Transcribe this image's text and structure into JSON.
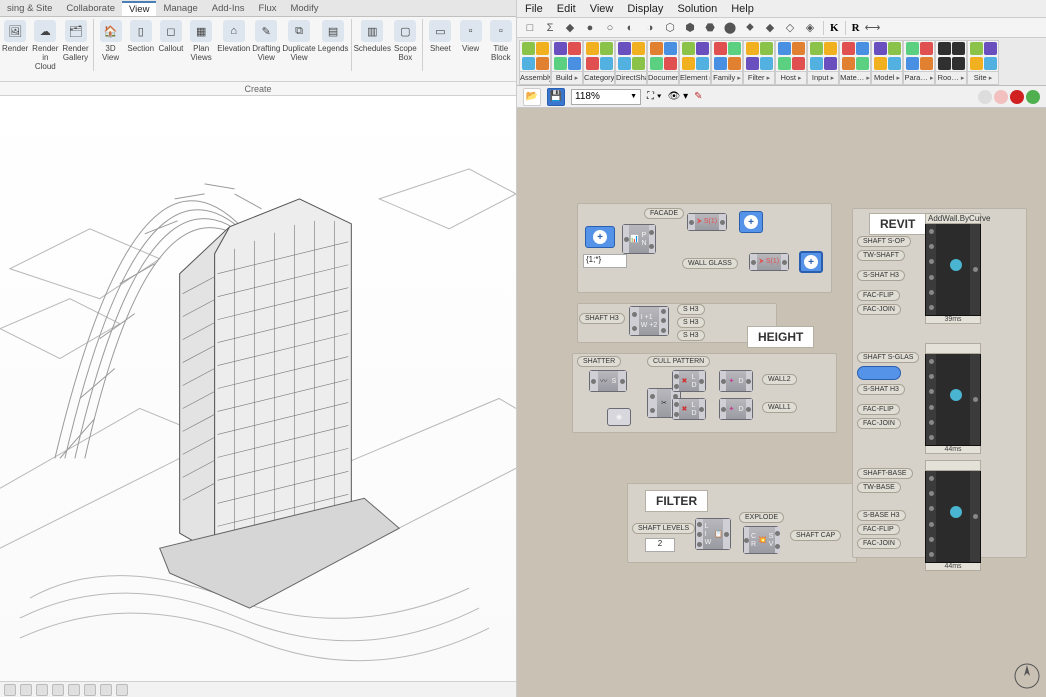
{
  "revit": {
    "tabs": [
      "sing & Site",
      "Collaborate",
      "View",
      "Manage",
      "Add-Ins",
      "Flux",
      "Modify"
    ],
    "active_tab": "View",
    "ribbon": [
      {
        "label": "Render",
        "icon": "🖼"
      },
      {
        "label": "Render in Cloud",
        "icon": "☁"
      },
      {
        "label": "Render Gallery",
        "icon": "🗂"
      },
      {
        "label": "3D View",
        "icon": "🏠"
      },
      {
        "label": "Section",
        "icon": "▯"
      },
      {
        "label": "Callout",
        "icon": "◻"
      },
      {
        "label": "Plan Views",
        "icon": "▦"
      },
      {
        "label": "Elevation",
        "icon": "⌂"
      },
      {
        "label": "Drafting View",
        "icon": "✎"
      },
      {
        "label": "Duplicate View",
        "icon": "⧉"
      },
      {
        "label": "Legends",
        "icon": "▤"
      },
      {
        "label": "Schedules",
        "icon": "▥"
      },
      {
        "label": "Scope Box",
        "icon": "▢"
      },
      {
        "label": "Sheet",
        "icon": "▭"
      },
      {
        "label": "View",
        "icon": "▫"
      },
      {
        "label": "Title Block",
        "icon": "▫"
      }
    ],
    "ribbon_group": "Create",
    "status_icons": 8
  },
  "gh": {
    "menu": [
      "File",
      "Edit",
      "View",
      "Display",
      "Solution",
      "Help"
    ],
    "tool1": [
      "□",
      "Σ",
      "◆",
      "●",
      "○",
      "◐",
      "◑",
      "⬡",
      "⬢",
      "⬣",
      "⬤",
      "⬥",
      "◆",
      "◇",
      "◈"
    ],
    "K": "K",
    "R": "R",
    "categories": [
      {
        "label": "Assembly",
        "c1": "#8bc34a",
        "c2": "#f0b020",
        "c3": "#52b1e0",
        "c4": "#e08030"
      },
      {
        "label": "Build",
        "c1": "#6a4fbf",
        "c2": "#e05050",
        "c3": "#5bd080",
        "c4": "#4a90e2"
      },
      {
        "label": "Category",
        "c1": "#f0b020",
        "c2": "#8bc34a",
        "c3": "#e05050",
        "c4": "#52b1e0"
      },
      {
        "label": "DirectShap…",
        "c1": "#6a4fbf",
        "c2": "#f0b020",
        "c3": "#52b1e0",
        "c4": "#8bc34a"
      },
      {
        "label": "Document",
        "c1": "#e08030",
        "c2": "#4a90e2",
        "c3": "#5bd080",
        "c4": "#e05050"
      },
      {
        "label": "Element",
        "c1": "#8bc34a",
        "c2": "#6a4fbf",
        "c3": "#f0b020",
        "c4": "#52b1e0"
      },
      {
        "label": "Family",
        "c1": "#e05050",
        "c2": "#5bd080",
        "c3": "#4a90e2",
        "c4": "#e08030"
      },
      {
        "label": "Filter",
        "c1": "#f0b020",
        "c2": "#8bc34a",
        "c3": "#6a4fbf",
        "c4": "#52b1e0"
      },
      {
        "label": "Host",
        "c1": "#4a90e2",
        "c2": "#e08030",
        "c3": "#5bd080",
        "c4": "#e05050"
      },
      {
        "label": "Input",
        "c1": "#8bc34a",
        "c2": "#f0b020",
        "c3": "#52b1e0",
        "c4": "#6a4fbf"
      },
      {
        "label": "Mate…",
        "c1": "#e05050",
        "c2": "#4a90e2",
        "c3": "#e08030",
        "c4": "#5bd080"
      },
      {
        "label": "Model",
        "c1": "#6a4fbf",
        "c2": "#8bc34a",
        "c3": "#f0b020",
        "c4": "#52b1e0"
      },
      {
        "label": "Para…",
        "c1": "#5bd080",
        "c2": "#e05050",
        "c3": "#4a90e2",
        "c4": "#e08030"
      },
      {
        "label": "Roo…",
        "c1": "#303030",
        "c2": "#303030",
        "c3": "#303030",
        "c4": "#303030"
      },
      {
        "label": "Site",
        "c1": "#8bc34a",
        "c2": "#6a4fbf",
        "c3": "#f0b020",
        "c4": "#52b1e0"
      }
    ],
    "zoom": "118%",
    "canvas": {
      "labels": {
        "revit": "REVIT",
        "height": "HEIGHT",
        "filter": "FILTER"
      },
      "pills": {
        "facade": "FACADE",
        "wallglass": "WALL GLASS",
        "shaft_h3_a": "SHAFT H3",
        "s_h3_a": "S H3",
        "s_h3_b": "S H3",
        "s_h3_c": "S H3",
        "shatter": "SHATTER",
        "cull": "CULL PATTERN",
        "wall2": "WALL2",
        "wall1": "WALL1",
        "shaftlevels": "SHAFT LEVELS",
        "explode": "EXPLODE",
        "shaftcap": "SHAFT CAP",
        "shaft_s_op": "SHAFT S-OP",
        "tw_shaft": "TW-SHAFT",
        "s_shaft_h3": "S-SHAT H3",
        "fac_flip": "FAC-FLIP",
        "fac_join": "FAC-JOIN",
        "shaft_s_glas": "SHAFT S-GLAS",
        "s_shaft_h3b": "S-SHAT H3",
        "fac_flip2": "FAC-FLIP",
        "fac_join2": "FAC-JOIN",
        "shaft_base": "SHAFT-BASE",
        "tw_base": "TW-BASE",
        "s_base_h3": "S-BASE H3",
        "fac_flip3": "FAC-FLIP",
        "fac_join3": "FAC-JOIN"
      },
      "panel_expr": "{1;*}",
      "slider_val": "2",
      "revit_comp": {
        "hdr": "AddWall.ByCurve",
        "t1": "39ms",
        "t2": "44ms",
        "t3": "44ms"
      }
    }
  }
}
